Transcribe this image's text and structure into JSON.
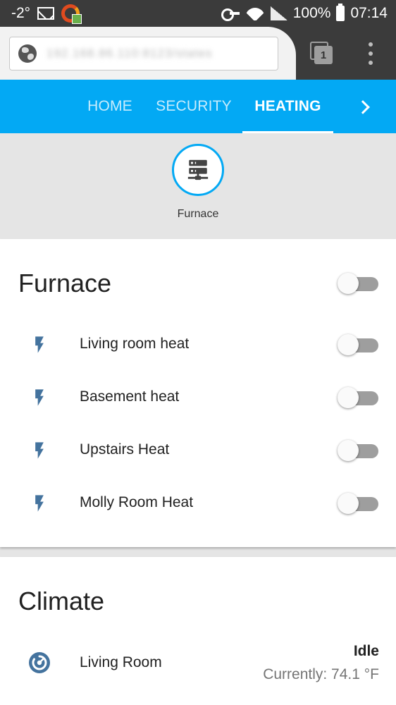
{
  "statusbar": {
    "temperature": "-2°",
    "battery": "100%",
    "time": "07:14"
  },
  "browser": {
    "url": "192.168.86.110:8123/states",
    "tab_count": "1"
  },
  "nav": {
    "tabs": [
      {
        "label": "HOME",
        "active": false
      },
      {
        "label": "SECURITY",
        "active": false
      },
      {
        "label": "HEATING",
        "active": true
      }
    ]
  },
  "badge": {
    "label": "Furnace",
    "icon": "server-network-icon",
    "color": "#03a9f4"
  },
  "furnace_card": {
    "title": "Furnace",
    "master_toggle": false,
    "rows": [
      {
        "label": "Living room heat",
        "icon": "flash-icon",
        "on": false
      },
      {
        "label": "Basement heat",
        "icon": "flash-icon",
        "on": false
      },
      {
        "label": "Upstairs Heat",
        "icon": "flash-icon",
        "on": false
      },
      {
        "label": "Molly Room Heat",
        "icon": "flash-icon",
        "on": false
      }
    ]
  },
  "climate_card": {
    "title": "Climate",
    "rows": [
      {
        "label": "Living Room",
        "icon": "thermostat-icon",
        "state": "Idle",
        "current": "Currently: 74.1 °F"
      }
    ]
  },
  "colors": {
    "primary": "#03a9f4",
    "icon": "#44739e",
    "toggle_off": "#9e9e9e"
  }
}
